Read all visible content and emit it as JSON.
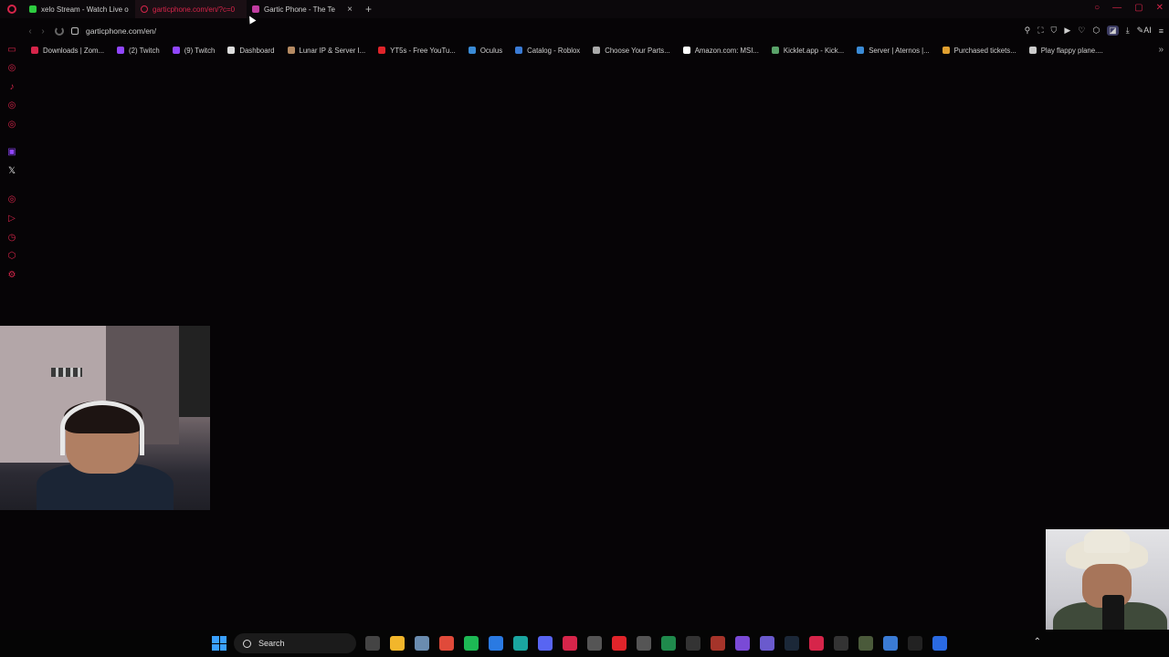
{
  "browser": {
    "tabs": [
      {
        "title": "xelo Stream - Watch Live o",
        "color": "#2ecc40",
        "active": false
      },
      {
        "title": "garticphone.com/en/?c=0",
        "color": "#d6254a",
        "active": true
      },
      {
        "title": "Gartic Phone - The Te",
        "color": "#c03ca0",
        "active": false
      }
    ],
    "new_tab_symbol": "+",
    "close_symbol": "×",
    "url": "garticphone.com/en/"
  },
  "bookmarks": [
    {
      "label": "Downloads | Zom...",
      "color": "#d6254a"
    },
    {
      "label": "(2) Twitch",
      "color": "#9146ff"
    },
    {
      "label": "(9) Twitch",
      "color": "#9146ff"
    },
    {
      "label": "Dashboard",
      "color": "#dddddd"
    },
    {
      "label": "Lunar IP & Server I...",
      "color": "#b58a62"
    },
    {
      "label": "YT5s - Free YouTu...",
      "color": "#e0242a"
    },
    {
      "label": "Oculus",
      "color": "#3a8bd6"
    },
    {
      "label": "Catalog - Roblox",
      "color": "#3a7bd5"
    },
    {
      "label": "Choose Your Parts...",
      "color": "#aaaaaa"
    },
    {
      "label": "Amazon.com: MSI...",
      "color": "#ffffff"
    },
    {
      "label": "Kicklet.app - Kick...",
      "color": "#5aa36a"
    },
    {
      "label": "Server | Aternos |...",
      "color": "#3a8bd6"
    },
    {
      "label": "Purchased tickets...",
      "color": "#e0a030"
    },
    {
      "label": "Play flappy plane....",
      "color": "#cccccc"
    }
  ],
  "toolbar": {
    "ai_label": "AI"
  },
  "taskbar": {
    "search_label": "Search",
    "apps": [
      {
        "name": "widgets",
        "color": "#444444"
      },
      {
        "name": "file-explorer",
        "color": "#f2b62b"
      },
      {
        "name": "photos",
        "color": "#6a8caf"
      },
      {
        "name": "chrome",
        "color": "#e04a3a"
      },
      {
        "name": "spotify",
        "color": "#1db954"
      },
      {
        "name": "editor",
        "color": "#2a7ae2"
      },
      {
        "name": "app-teal",
        "color": "#1aa6a0"
      },
      {
        "name": "discord",
        "color": "#5865f2"
      },
      {
        "name": "media-player",
        "color": "#d6254a"
      },
      {
        "name": "calculator",
        "color": "#555555"
      },
      {
        "name": "youtube",
        "color": "#e0242a"
      },
      {
        "name": "atom",
        "color": "#555555"
      },
      {
        "name": "excel",
        "color": "#1f8a4c"
      },
      {
        "name": "ez-app",
        "color": "#333333"
      },
      {
        "name": "app-red",
        "color": "#a5342a"
      },
      {
        "name": "app-purple",
        "color": "#7a4ad6"
      },
      {
        "name": "gamepad",
        "color": "#6a5acd"
      },
      {
        "name": "steam",
        "color": "#1b2838"
      },
      {
        "name": "opera-gx",
        "color": "#d6254a"
      },
      {
        "name": "app-g",
        "color": "#333333"
      },
      {
        "name": "app-green",
        "color": "#4a5a3a"
      },
      {
        "name": "app-blue-circle",
        "color": "#3a7bd5"
      },
      {
        "name": "tiktok",
        "color": "#222222"
      },
      {
        "name": "app-blue-sq",
        "color": "#2a6ae2"
      }
    ]
  },
  "sidebar_icons": [
    "gx-control",
    "gx-corner",
    "music",
    "player",
    "social",
    "twitch",
    "x",
    "instagram",
    "player-2",
    "history",
    "extensions",
    "settings"
  ]
}
